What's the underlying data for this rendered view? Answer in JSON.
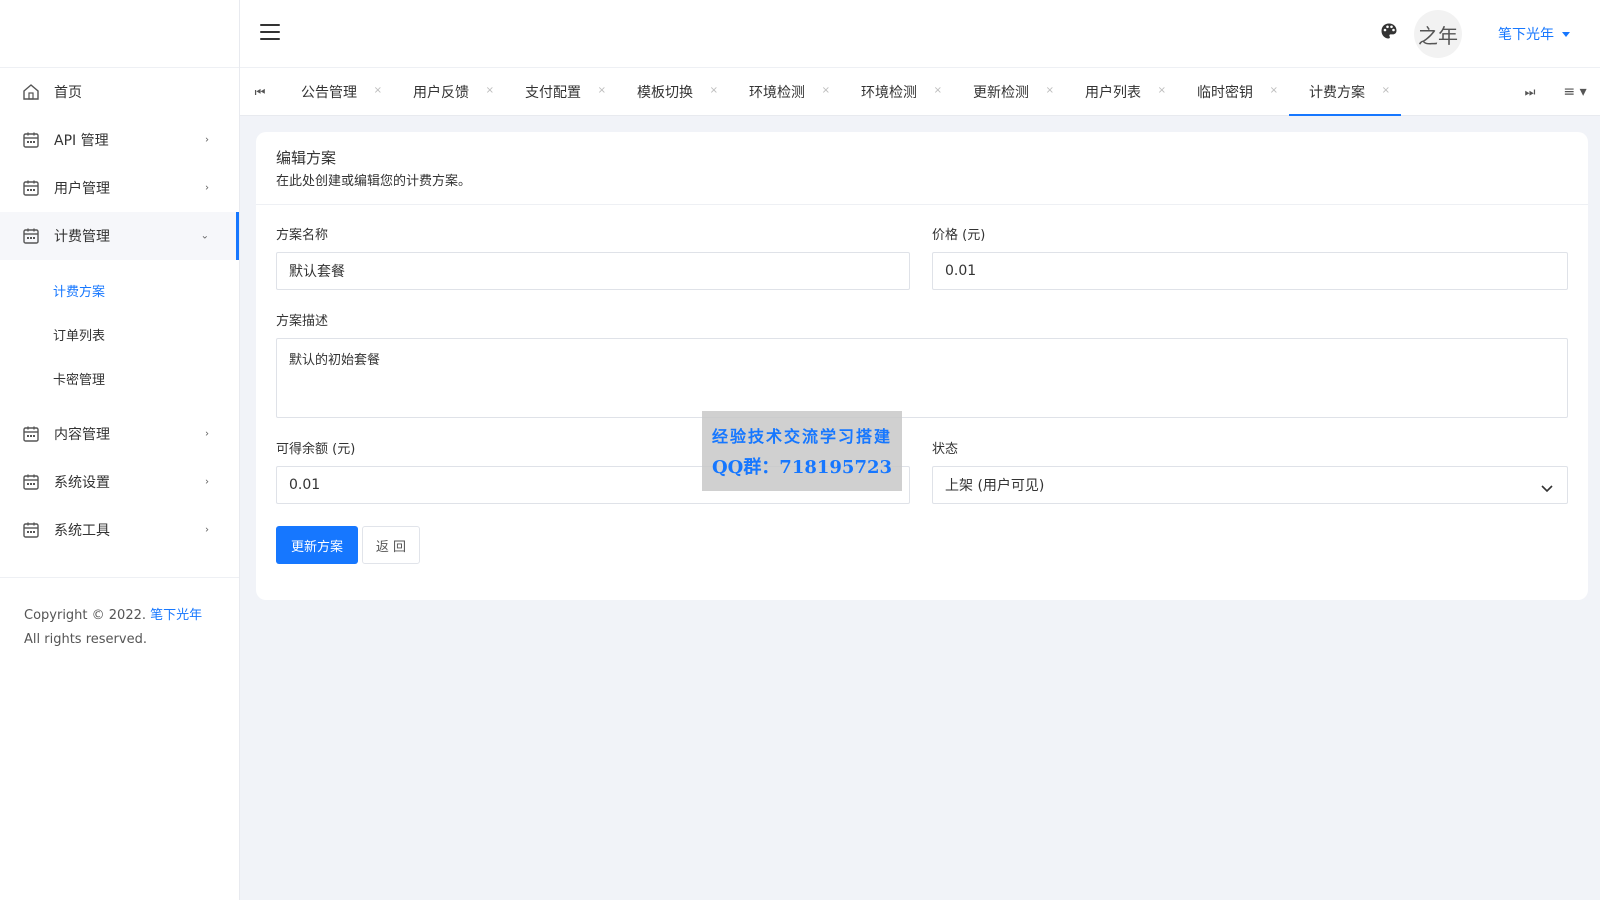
{
  "sidebar": {
    "items": [
      {
        "label": "首页",
        "icon": "home-icon"
      },
      {
        "label": "API 管理",
        "icon": "calendar-icon"
      },
      {
        "label": "用户管理",
        "icon": "calendar-icon"
      },
      {
        "label": "计费管理",
        "icon": "calendar-icon"
      },
      {
        "label": "内容管理",
        "icon": "calendar-icon"
      },
      {
        "label": "系统设置",
        "icon": "calendar-icon"
      },
      {
        "label": "系统工具",
        "icon": "calendar-icon"
      }
    ],
    "subitems": [
      {
        "label": "计费方案"
      },
      {
        "label": "订单列表"
      },
      {
        "label": "卡密管理"
      }
    ],
    "footer": {
      "prefix": "Copyright © 2022.",
      "link": "笔下光年",
      "suffix": "All rights reserved."
    }
  },
  "header": {
    "user_name": "笔下光年",
    "avatar_text": "之年"
  },
  "tabs": [
    {
      "label": "公告管理"
    },
    {
      "label": "用户反馈"
    },
    {
      "label": "支付配置"
    },
    {
      "label": "模板切换"
    },
    {
      "label": "环境检测"
    },
    {
      "label": "环境检测"
    },
    {
      "label": "更新检测"
    },
    {
      "label": "用户列表"
    },
    {
      "label": "临时密钥"
    },
    {
      "label": "计费方案"
    }
  ],
  "form": {
    "title": "编辑方案",
    "subtitle": "在此处创建或编辑您的计费方案。",
    "name_label": "方案名称",
    "name_value": "默认套餐",
    "price_label": "价格 (元)",
    "price_value": "0.01",
    "desc_label": "方案描述",
    "desc_value": "默认的初始套餐",
    "balance_label": "可得余额 (元)",
    "balance_value": "0.01",
    "status_label": "状态",
    "status_value": "上架 (用户可见)",
    "submit_label": "更新方案",
    "back_label": "返 回"
  },
  "watermark": {
    "line1": "经验技术交流学习搭建",
    "line2": "QQ群：718195723"
  },
  "colors": {
    "accent": "#1677ff",
    "background": "#f1f3f8"
  }
}
